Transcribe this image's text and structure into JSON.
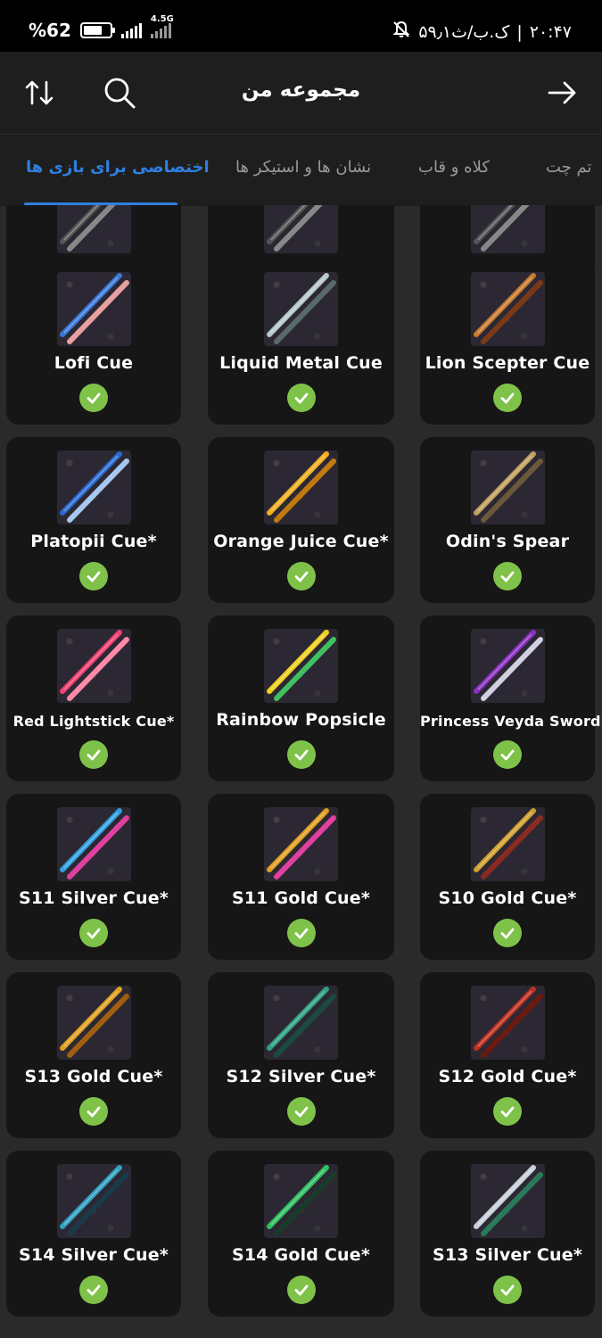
{
  "status_bar": {
    "battery_percent": "%62",
    "network": "4.5G",
    "time": "۲۰:۴۷",
    "speed": "۵۹٫۱ک.ب/ث",
    "separator": "|"
  },
  "header": {
    "title": "مجموعه من",
    "icons": [
      "sort-icon",
      "search-icon",
      "back-arrow-icon"
    ]
  },
  "tabs": [
    {
      "label": "اختصاصی برای بازی ها",
      "active": true
    },
    {
      "label": "نشان ها و استیکر ها",
      "active": false
    },
    {
      "label": "کلاه و قاب",
      "active": false
    },
    {
      "label": "تم چت",
      "active": false
    }
  ],
  "items": [
    {
      "name": "",
      "owned": true,
      "colors": [
        "#555",
        "#888"
      ]
    },
    {
      "name": "",
      "owned": true,
      "colors": [
        "#555",
        "#888"
      ]
    },
    {
      "name": "",
      "owned": true,
      "colors": [
        "#555",
        "#888"
      ]
    },
    {
      "name": "Lofi Cue",
      "owned": true,
      "colors": [
        "#3a78d8",
        "#e8a0a0"
      ]
    },
    {
      "name": "Liquid Metal Cue",
      "owned": true,
      "colors": [
        "#b8c8c8",
        "#5a6a6a"
      ]
    },
    {
      "name": "Lion Scepter Cue",
      "owned": true,
      "colors": [
        "#c87a30",
        "#7a3a18"
      ]
    },
    {
      "name": "Platopii Cue*",
      "owned": true,
      "colors": [
        "#2a6ad0",
        "#a8c8f0"
      ]
    },
    {
      "name": "Orange Juice Cue*",
      "owned": true,
      "colors": [
        "#f0b020",
        "#c07a10"
      ]
    },
    {
      "name": "Odin's Spear",
      "owned": true,
      "colors": [
        "#c0a060",
        "#6a5a3a"
      ]
    },
    {
      "name": "Red Lightstick Cue*",
      "owned": true,
      "colors": [
        "#f04070",
        "#ff8aa8"
      ]
    },
    {
      "name": "Rainbow Popsicle",
      "owned": true,
      "colors": [
        "#f0d020",
        "#40c060"
      ]
    },
    {
      "name": "Princess Veyda Sword",
      "owned": true,
      "colors": [
        "#8a30c0",
        "#d0d0e0"
      ]
    },
    {
      "name": "S11 Silver Cue*",
      "owned": true,
      "colors": [
        "#30a0e0",
        "#e040a0"
      ]
    },
    {
      "name": "S11 Gold Cue*",
      "owned": true,
      "colors": [
        "#e0a020",
        "#e040a0"
      ]
    },
    {
      "name": "S10 Gold Cue*",
      "owned": true,
      "colors": [
        "#d0a030",
        "#8a2a20"
      ]
    },
    {
      "name": "S13 Gold Cue*",
      "owned": true,
      "colors": [
        "#e0a020",
        "#a06010"
      ]
    },
    {
      "name": "S12 Silver Cue*",
      "owned": true,
      "colors": [
        "#30a080",
        "#1a4a40"
      ]
    },
    {
      "name": "S12 Gold Cue*",
      "owned": true,
      "colors": [
        "#c03020",
        "#6a1a10"
      ]
    },
    {
      "name": "S14 Silver Cue*",
      "owned": true,
      "colors": [
        "#30a0c0",
        "#1a3a4a"
      ]
    },
    {
      "name": "S14 Gold Cue*",
      "owned": true,
      "colors": [
        "#30c060",
        "#1a3a2a"
      ]
    },
    {
      "name": "S13 Silver Cue*",
      "owned": true,
      "colors": [
        "#c8d0d8",
        "#2a7a5a"
      ]
    }
  ]
}
